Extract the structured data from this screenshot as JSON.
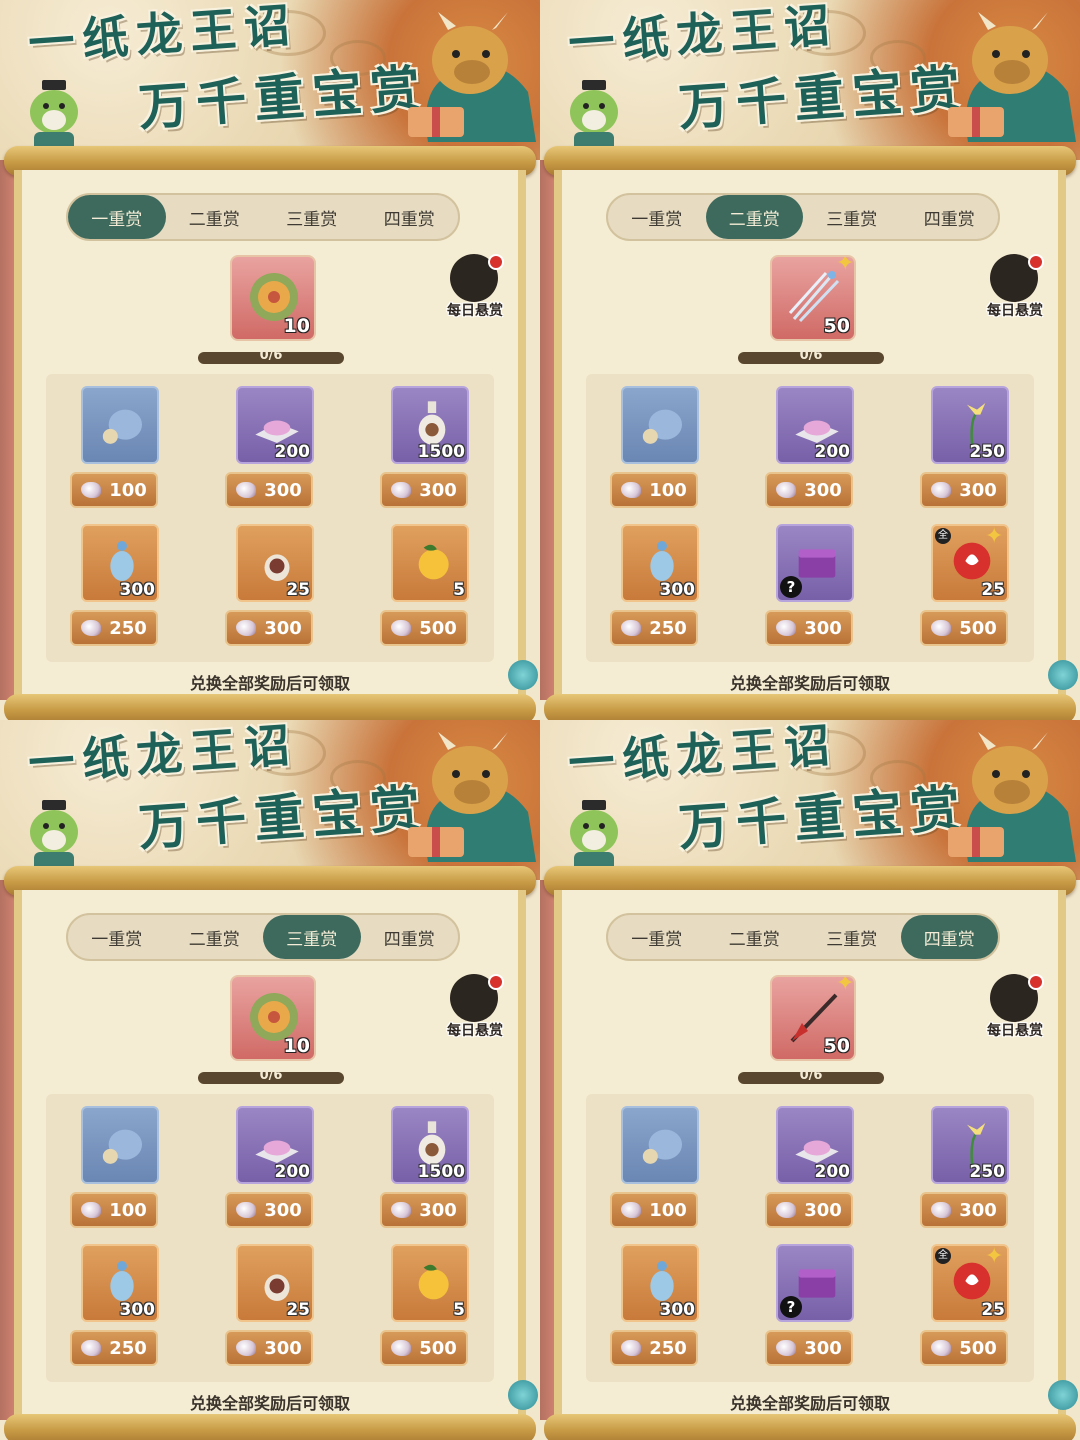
{
  "title_line1": "一纸龙王诏",
  "title_line2": "万千重宝赏",
  "tabs": [
    "一重赏",
    "二重赏",
    "三重赏",
    "四重赏"
  ],
  "daily_label": "每日悬赏",
  "footnote": "兑换全部奖励后可领取",
  "colors": {
    "tab_active": "#3d6a5c",
    "title": "#1e6158",
    "price_bg": "#c98748"
  },
  "panels": [
    {
      "active_tab": 0,
      "main": {
        "icon": "dragon-coin-icon",
        "qty": "10",
        "bg": "red",
        "star": false
      },
      "progress": {
        "label": "0/6",
        "value": 0
      },
      "items": [
        {
          "icon": "coin-pouch-icon",
          "qty": "",
          "price": "100",
          "bg": "blue"
        },
        {
          "icon": "pink-powder-icon",
          "qty": "200",
          "price": "300",
          "bg": "purple"
        },
        {
          "icon": "potion-bottle-icon",
          "qty": "1500",
          "price": "300",
          "bg": "purple"
        },
        {
          "icon": "blue-vase-icon",
          "qty": "300",
          "price": "250",
          "bg": "orange"
        },
        {
          "icon": "mask-bottle-icon",
          "qty": "25",
          "price": "300",
          "bg": "orange"
        },
        {
          "icon": "orange-fruit-icon",
          "qty": "5",
          "price": "500",
          "bg": "orange"
        }
      ]
    },
    {
      "active_tab": 1,
      "main": {
        "icon": "ice-arrows-icon",
        "qty": "50",
        "bg": "red",
        "star": true
      },
      "progress": {
        "label": "0/6",
        "value": 0
      },
      "items": [
        {
          "icon": "coin-pouch-icon",
          "qty": "",
          "price": "100",
          "bg": "blue"
        },
        {
          "icon": "pink-powder-icon",
          "qty": "200",
          "price": "300",
          "bg": "purple"
        },
        {
          "icon": "lily-flower-icon",
          "qty": "250",
          "price": "300",
          "bg": "purple"
        },
        {
          "icon": "blue-vase-icon",
          "qty": "300",
          "price": "250",
          "bg": "orange"
        },
        {
          "icon": "mystery-chest-icon",
          "qty": "",
          "price": "300",
          "bg": "purple",
          "question": true
        },
        {
          "icon": "red-orb-icon",
          "qty": "25",
          "price": "500",
          "bg": "orange",
          "star": true,
          "quan": "全"
        }
      ]
    },
    {
      "active_tab": 2,
      "main": {
        "icon": "dragon-coin-icon",
        "qty": "10",
        "bg": "red",
        "star": false
      },
      "progress": {
        "label": "0/6",
        "value": 0
      },
      "items": [
        {
          "icon": "coin-pouch-icon",
          "qty": "",
          "price": "100",
          "bg": "blue"
        },
        {
          "icon": "pink-powder-icon",
          "qty": "200",
          "price": "300",
          "bg": "purple"
        },
        {
          "icon": "potion-bottle-icon",
          "qty": "1500",
          "price": "300",
          "bg": "purple"
        },
        {
          "icon": "blue-vase-icon",
          "qty": "300",
          "price": "250",
          "bg": "orange"
        },
        {
          "icon": "mask-bottle-icon",
          "qty": "25",
          "price": "300",
          "bg": "orange"
        },
        {
          "icon": "orange-fruit-icon",
          "qty": "5",
          "price": "500",
          "bg": "orange"
        }
      ]
    },
    {
      "active_tab": 3,
      "main": {
        "icon": "red-spear-icon",
        "qty": "50",
        "bg": "red",
        "star": true
      },
      "progress": {
        "label": "0/6",
        "value": 0
      },
      "items": [
        {
          "icon": "coin-pouch-icon",
          "qty": "",
          "price": "100",
          "bg": "blue"
        },
        {
          "icon": "pink-powder-icon",
          "qty": "200",
          "price": "300",
          "bg": "purple"
        },
        {
          "icon": "lily-flower-icon",
          "qty": "250",
          "price": "300",
          "bg": "purple"
        },
        {
          "icon": "blue-vase-icon",
          "qty": "300",
          "price": "250",
          "bg": "orange"
        },
        {
          "icon": "mystery-chest-icon",
          "qty": "",
          "price": "300",
          "bg": "purple",
          "question": true
        },
        {
          "icon": "red-orb-icon",
          "qty": "25",
          "price": "500",
          "bg": "orange",
          "star": true,
          "quan": "全"
        }
      ]
    }
  ]
}
